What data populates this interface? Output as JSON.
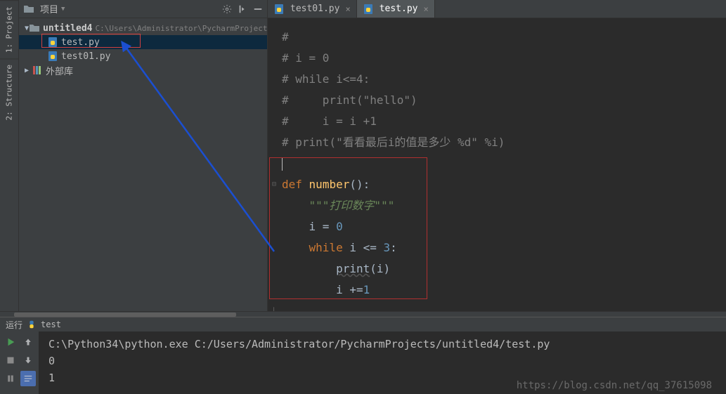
{
  "sidebar": {
    "tabs": [
      {
        "label": "1: Project",
        "icon": "project-icon"
      },
      {
        "label": "2: Structure",
        "icon": "structure-icon"
      }
    ]
  },
  "projectPanel": {
    "title": "项目",
    "root": {
      "name": "untitled4",
      "path": "C:\\Users\\Administrator\\PycharmProjects\\"
    },
    "files": [
      {
        "name": "test.py",
        "icon": "python-file"
      },
      {
        "name": "test01.py",
        "icon": "python-file"
      }
    ],
    "lib": "外部库"
  },
  "tabs": [
    {
      "label": "test01.py",
      "active": false
    },
    {
      "label": "test.py",
      "active": true
    }
  ],
  "code": {
    "lines": [
      {
        "t": "cm",
        "txt": "#"
      },
      {
        "t": "cm",
        "txt": "# i = 0"
      },
      {
        "t": "cm",
        "txt": "# while i<=4:"
      },
      {
        "t": "cm",
        "txt": "#     print(\"hello\")"
      },
      {
        "t": "cm",
        "txt": "#     i = i +1"
      },
      {
        "t": "cm",
        "txt": "# print(\"看看最后i的值是多少 %d\" %i)"
      },
      {
        "t": "caret",
        "txt": ""
      },
      {
        "t": "def",
        "kw": "def",
        "fn": "number",
        "paren": "()",
        "colon": ":"
      },
      {
        "t": "doc",
        "txt": "    \"\"\"打印数字\"\"\""
      },
      {
        "t": "assign",
        "indent": "    ",
        "id": "i",
        "op": " = ",
        "num": "0"
      },
      {
        "t": "while",
        "indent": "    ",
        "kw": "while",
        "cond": " i <= ",
        "num": "3",
        "colon": ":"
      },
      {
        "t": "print",
        "indent": "        ",
        "fn": "print",
        "arg": "(i)"
      },
      {
        "t": "inc",
        "indent": "        ",
        "id": "i ",
        "op": "+=",
        "num": "1"
      }
    ]
  },
  "runPanel": {
    "title": "运行",
    "config": "test",
    "cmd": "C:\\Python34\\python.exe C:/Users/Administrator/PycharmProjects/untitled4/test.py",
    "out": [
      "0",
      "1"
    ]
  },
  "watermark": "https://blog.csdn.net/qq_37615098"
}
